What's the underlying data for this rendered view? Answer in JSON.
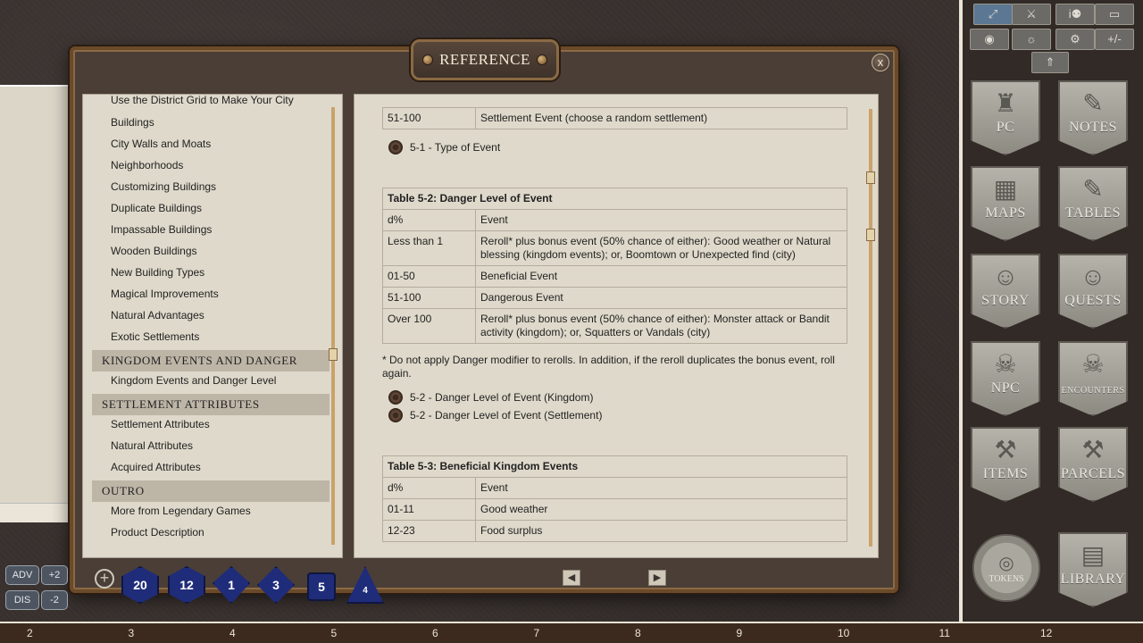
{
  "window": {
    "title": "REFERENCE",
    "close_label": "x"
  },
  "toc": {
    "items": [
      {
        "type": "item",
        "label": "Use the District Grid to Make Your City",
        "cut": true
      },
      {
        "type": "item",
        "label": "Buildings"
      },
      {
        "type": "item",
        "label": "City Walls and Moats"
      },
      {
        "type": "item",
        "label": "Neighborhoods"
      },
      {
        "type": "item",
        "label": "Customizing Buildings"
      },
      {
        "type": "item",
        "label": "Duplicate Buildings"
      },
      {
        "type": "item",
        "label": "Impassable Buildings"
      },
      {
        "type": "item",
        "label": "Wooden Buildings"
      },
      {
        "type": "item",
        "label": "New Building Types"
      },
      {
        "type": "item",
        "label": "Magical Improvements"
      },
      {
        "type": "item",
        "label": "Natural Advantages"
      },
      {
        "type": "item",
        "label": "Exotic Settlements"
      },
      {
        "type": "header",
        "label": "KINGDOM EVENTS AND DANGER"
      },
      {
        "type": "item",
        "label": "Kingdom Events and Danger Level"
      },
      {
        "type": "header",
        "label": "SETTLEMENT ATTRIBUTES"
      },
      {
        "type": "item",
        "label": "Settlement Attributes"
      },
      {
        "type": "item",
        "label": "Natural Attributes"
      },
      {
        "type": "item",
        "label": "Acquired Attributes"
      },
      {
        "type": "header",
        "label": "OUTRO"
      },
      {
        "type": "item",
        "label": "More from Legendary Games"
      },
      {
        "type": "item",
        "label": "Product Description"
      }
    ]
  },
  "content": {
    "table_top": {
      "rows": [
        [
          "51-100",
          "Settlement Event (choose a random settlement)"
        ]
      ]
    },
    "link_5_1": "5-1 - Type of Event",
    "table_5_2": {
      "caption": "Table 5-2: Danger Level of Event",
      "headers": [
        "d%",
        "Event"
      ],
      "rows": [
        [
          "Less than 1",
          "Reroll* plus bonus event (50% chance of either): Good weather or Natural blessing (kingdom events); or, Boomtown or Unexpected find (city)"
        ],
        [
          "01-50",
          "Beneficial Event"
        ],
        [
          "51-100",
          "Dangerous Event"
        ],
        [
          "Over 100",
          "Reroll* plus bonus event (50% chance of either): Monster attack or Bandit activity (kingdom); or, Squatters or Vandals (city)"
        ]
      ]
    },
    "note": "* Do not apply Danger modifier to rerolls. In addition, if the reroll duplicates the bonus event, roll again.",
    "link_5_2_kingdom": "5-2 - Danger Level of Event (Kingdom)",
    "link_5_2_settlement": "5-2 - Danger Level of Event (Settlement)",
    "table_5_3": {
      "caption": "Table 5-3: Beneficial Kingdom Events",
      "headers": [
        "d%",
        "Event"
      ],
      "rows": [
        [
          "01-11",
          "Good weather"
        ],
        [
          "12-23",
          "Food surplus"
        ]
      ]
    }
  },
  "nav": {
    "prev": "◀",
    "next": "▶"
  },
  "sidebar": {
    "toolbar": [
      {
        "name": "pointer-tool",
        "glyph": "⤢",
        "active": true
      },
      {
        "name": "combat-tool",
        "glyph": "⚔"
      },
      {
        "name": "party-tool",
        "glyph": "i⚉"
      },
      {
        "name": "notes-tool",
        "glyph": "▭"
      },
      {
        "name": "color-tool",
        "glyph": "◉"
      },
      {
        "name": "lighting-tool",
        "glyph": "☼"
      },
      {
        "name": "options-tool",
        "glyph": "⚙"
      },
      {
        "name": "modifier-tool",
        "glyph": "+/-"
      },
      {
        "name": "up-tool",
        "glyph": "⇑"
      }
    ],
    "banners": [
      {
        "label": "PC",
        "icon": "♜"
      },
      {
        "label": "NOTES",
        "icon": "✎"
      },
      {
        "label": "MAPS",
        "icon": "▦"
      },
      {
        "label": "TABLES",
        "icon": "✎"
      },
      {
        "label": "STORY",
        "icon": "☺"
      },
      {
        "label": "QUESTS",
        "icon": "☺"
      },
      {
        "label": "NPC",
        "icon": "☠"
      },
      {
        "label": "ENCOUNTERS",
        "icon": "☠"
      },
      {
        "label": "ITEMS",
        "icon": "⚒"
      },
      {
        "label": "PARCELS",
        "icon": "⚒"
      },
      {
        "label": "LIBRARY",
        "icon": "▤"
      }
    ],
    "tokens_label": "TOKENS"
  },
  "dicebar": {
    "adv": "ADV",
    "dis": "DIS",
    "plus2": "+2",
    "minus2": "-2",
    "dice": [
      {
        "name": "d20-die",
        "label": "20",
        "shape": "d20"
      },
      {
        "name": "d12-die",
        "label": "12",
        "shape": "d20"
      },
      {
        "name": "d10-die",
        "label": "1",
        "shape": "d10"
      },
      {
        "name": "d8-die",
        "label": "3",
        "shape": "d8"
      },
      {
        "name": "d6-die",
        "label": "5",
        "shape": "d6"
      },
      {
        "name": "d4-die",
        "label": "4",
        "shape": "d4"
      }
    ]
  },
  "ruler": [
    "2",
    "3",
    "4",
    "5",
    "6",
    "7",
    "8",
    "9",
    "10",
    "11",
    "12"
  ]
}
